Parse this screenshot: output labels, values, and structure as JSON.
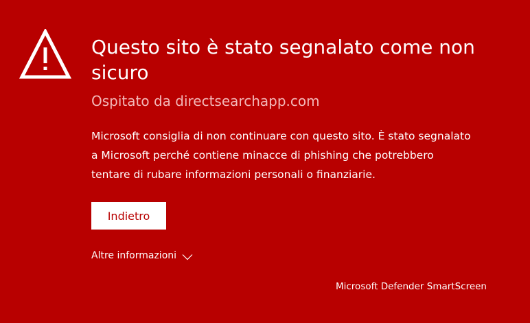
{
  "warning": {
    "icon": "warning-triangle-icon",
    "title": "Questo sito è stato segnalato come non sicuro",
    "host": "Ospitato da directsearchapp.com",
    "description": "Microsoft consiglia di non continuare con questo sito. È stato segnalato a Microsoft perché contiene minacce di phishing che potrebbero tentare di rubare informazioni personali o finanziarie."
  },
  "actions": {
    "back_label": "Indietro",
    "more_info_label": "Altre informazioni",
    "more_info_icon": "chevron-down-icon"
  },
  "footer": {
    "brand": "Microsoft Defender SmartScreen"
  },
  "colors": {
    "background": "#b80000",
    "text": "#ffffff",
    "host_text": "#f3b8b8",
    "button_background": "#ffffff",
    "button_text": "#b80000"
  }
}
